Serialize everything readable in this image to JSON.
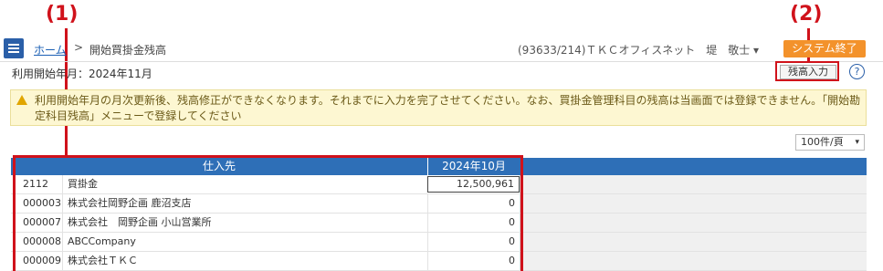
{
  "annotations": {
    "label1": "(1)",
    "label2": "(2)"
  },
  "header": {
    "home_link": "ホーム",
    "separator": ">",
    "current_page": "開始買掛金残高",
    "user_info": "(93633/214)ＴＫＣオフィスネット　堤　敬士 ▾",
    "system_exit": "システム終了"
  },
  "subheader": {
    "period": "利用開始年月：2024年11月",
    "balance_input_button": "残高入力",
    "help_icon": "?"
  },
  "warning": {
    "text": "利用開始年月の月次更新後、残高修正ができなくなります。それまでに入力を完了させてください。なお、買掛金管理科目の残高は当画面では登録できません。「開始勘定科目残高」メニューで登録してください"
  },
  "per_page": {
    "value": "100件/頁",
    "caret": "▾"
  },
  "table": {
    "headers": {
      "supplier": "仕入先",
      "month": "2024年10月"
    },
    "rows": [
      {
        "code": "2112",
        "name": "買掛金",
        "value": "12,500,961"
      },
      {
        "code": "000003",
        "name": "株式会社岡野企画 鹿沼支店",
        "value": "0"
      },
      {
        "code": "000007",
        "name": "株式会社　岡野企画 小山営業所",
        "value": "0"
      },
      {
        "code": "000008",
        "name": "ABCCompany",
        "value": "0"
      },
      {
        "code": "000009",
        "name": "株式会社ＴＫＣ",
        "value": "0"
      }
    ]
  },
  "colors": {
    "accent": "#2e6fb7",
    "annotation": "#d0121b",
    "exit_button": "#f3922b",
    "warning_bg": "#fdf7d2"
  }
}
